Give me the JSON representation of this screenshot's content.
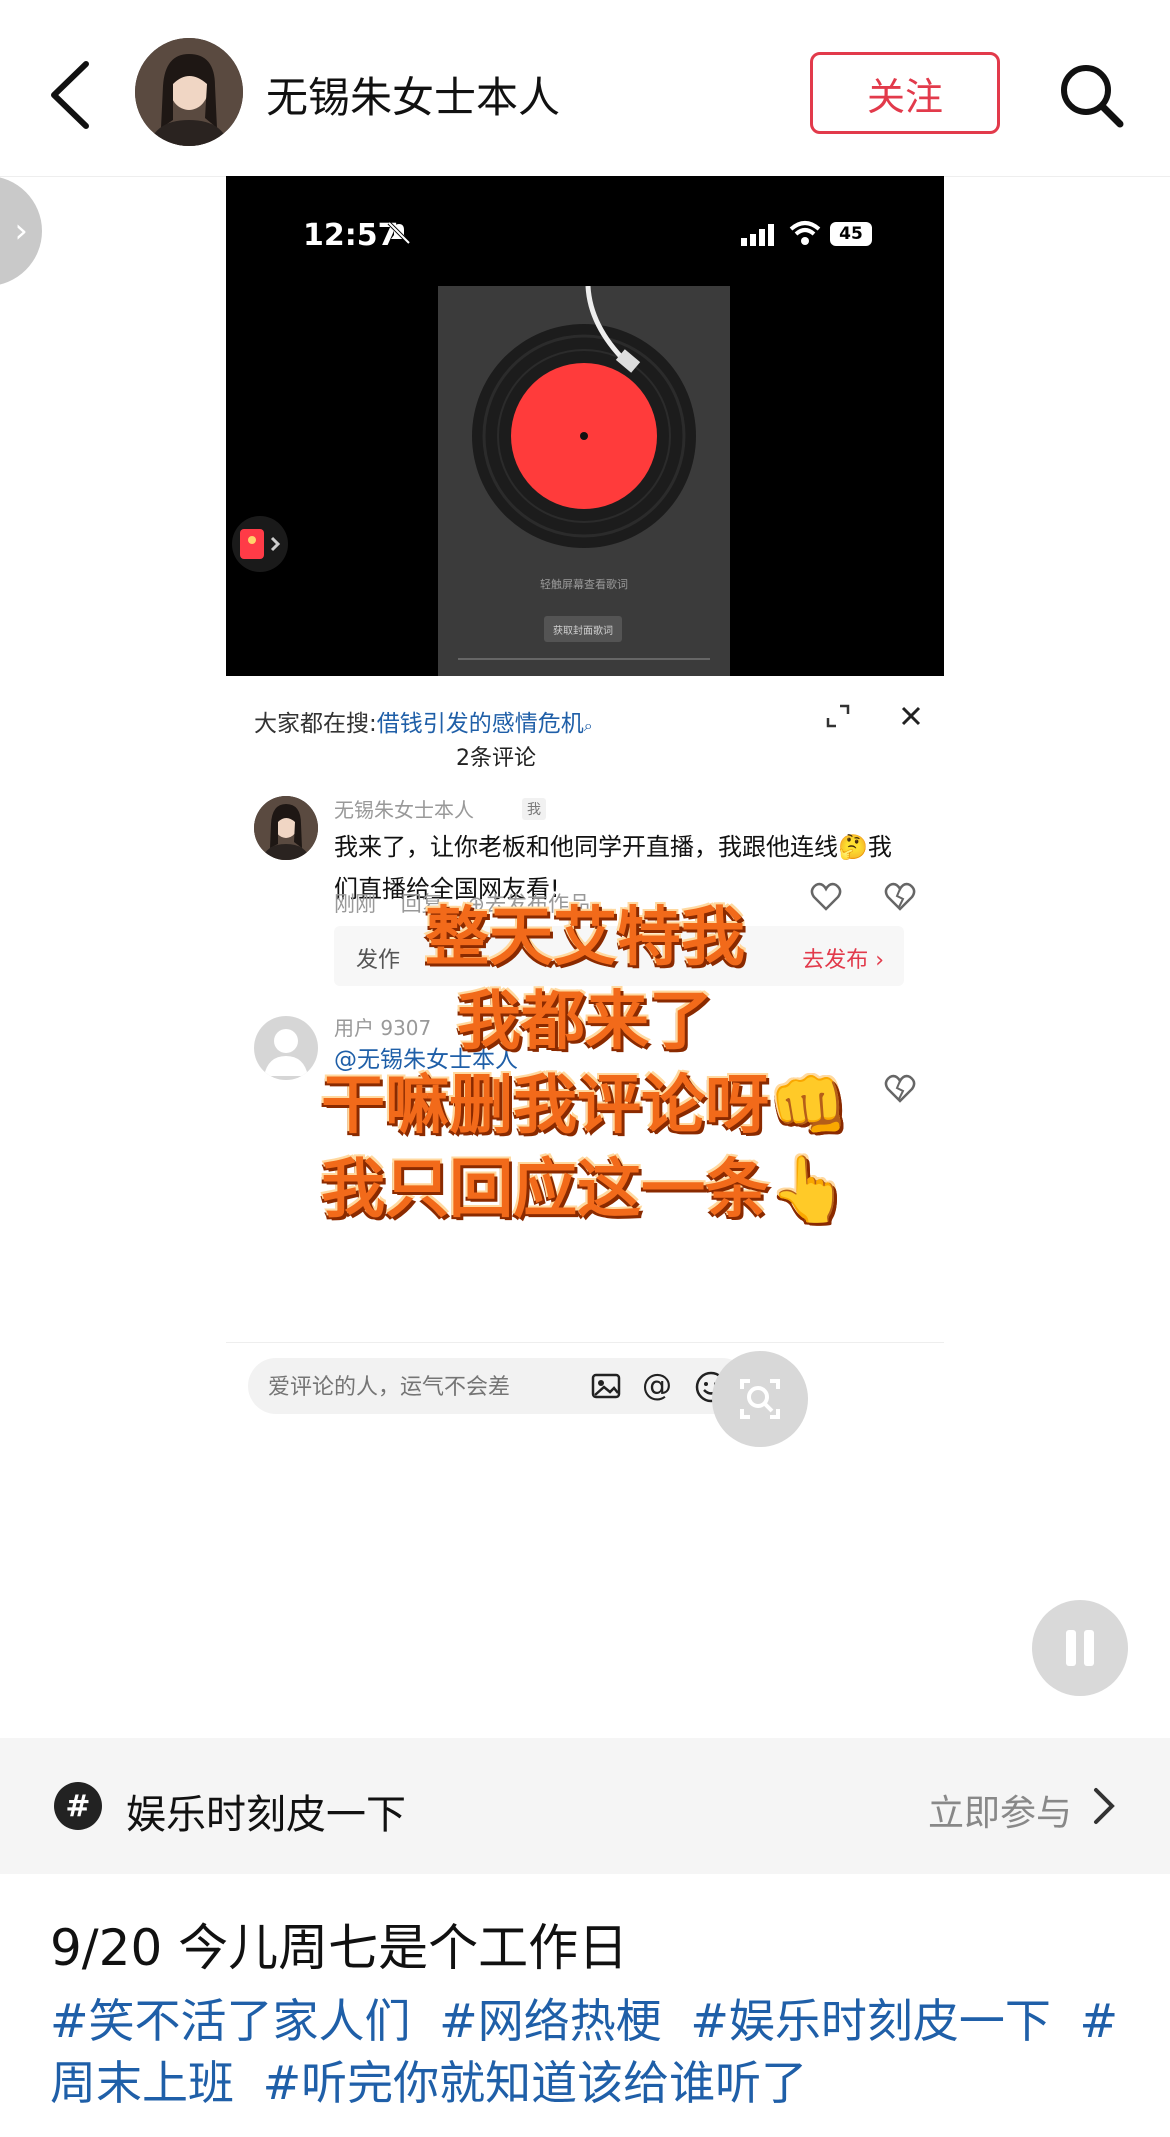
{
  "header": {
    "author_name": "无锡朱女士本人",
    "follow_label": "关注"
  },
  "phone": {
    "clock": "12:57",
    "battery": "45",
    "player_hint": "轻触屏幕查看歌词",
    "player_button": "获取封面歌词"
  },
  "comments_panel": {
    "search_prefix": "大家都在搜:",
    "search_keyword": "借钱引发的感情危机",
    "count_label": "2条评论",
    "comments": [
      {
        "author": "无锡朱女士本人",
        "me_badge": "我",
        "text": "我来了，让你老板和他同学开直播，我跟他连线🤔我们直播给全国网友看!",
        "time": "刚刚",
        "reply": "回复",
        "publish": "⊕去发布作品"
      },
      {
        "author": "用户 9307",
        "mention": "@无锡朱女士本人"
      }
    ],
    "publish_box": {
      "text": "发作",
      "action": "去发布 ›"
    },
    "overlay_lines": [
      "整天艾特我",
      "我都来了",
      "干嘛删我评论呀👊",
      "我只回应这一条👆"
    ],
    "input_placeholder": "爱评论的人，运气不会差"
  },
  "topic": {
    "name": "娱乐时刻皮一下",
    "join_label": "立即参与"
  },
  "post": {
    "title": "9/20 今儿周七是个工作日",
    "tags": [
      "#笑不活了家人们",
      "#网络热梗",
      "#娱乐时刻皮一下",
      "#周末上班",
      "#听完你就知道该给谁听了"
    ]
  },
  "colors": {
    "accent_red": "#e23a4b",
    "link_blue": "#1f5fa8",
    "overlay_orange": "#f26a1a"
  }
}
